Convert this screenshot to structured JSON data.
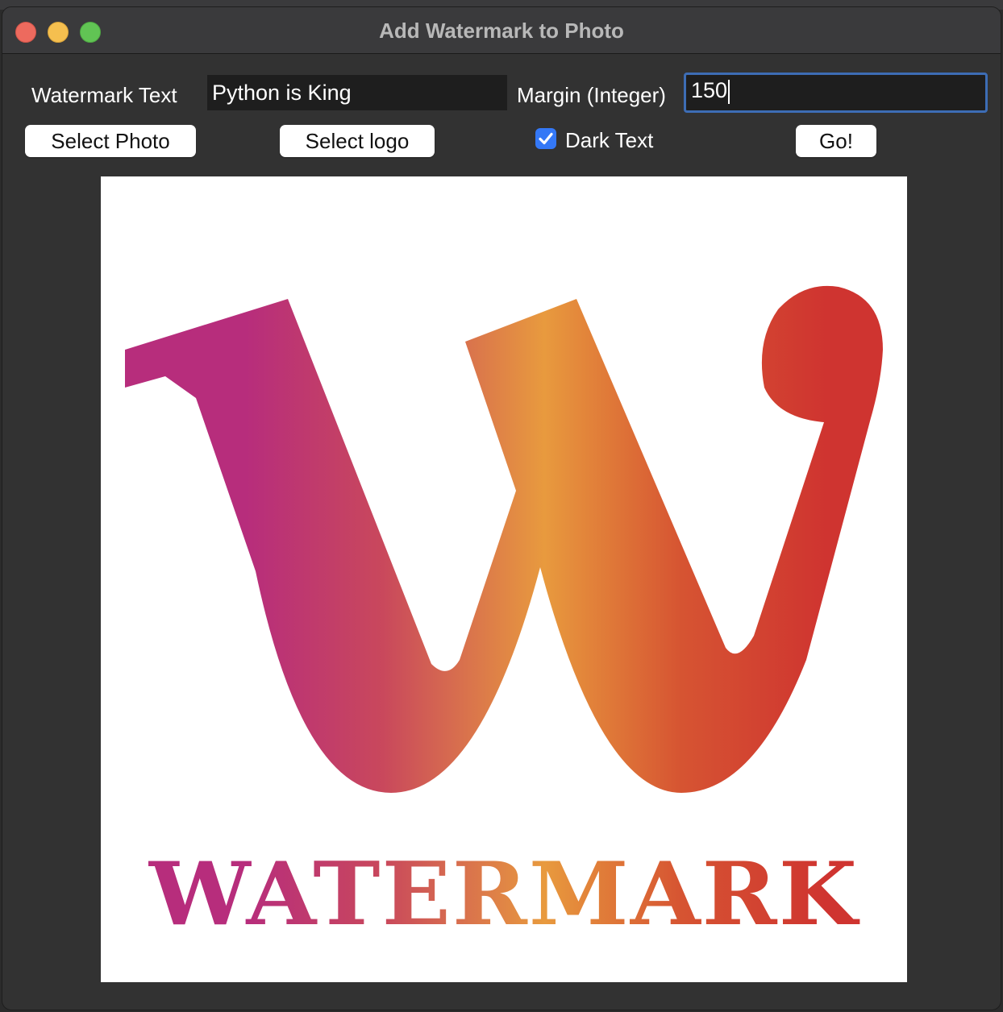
{
  "window": {
    "title": "Add Watermark to Photo"
  },
  "form": {
    "watermark_text_label": "Watermark Text",
    "watermark_text_value": "Python is King",
    "margin_label": "Margin (Integer)",
    "margin_value": "150",
    "select_photo_label": "Select Photo",
    "select_logo_label": "Select logo",
    "dark_text_label": "Dark Text",
    "dark_text_checked": true,
    "go_label": "Go!"
  },
  "preview": {
    "logo_text": "WATERMARK",
    "gradient_colors": [
      "#b72d7c",
      "#e89a3e",
      "#cf3430"
    ]
  }
}
